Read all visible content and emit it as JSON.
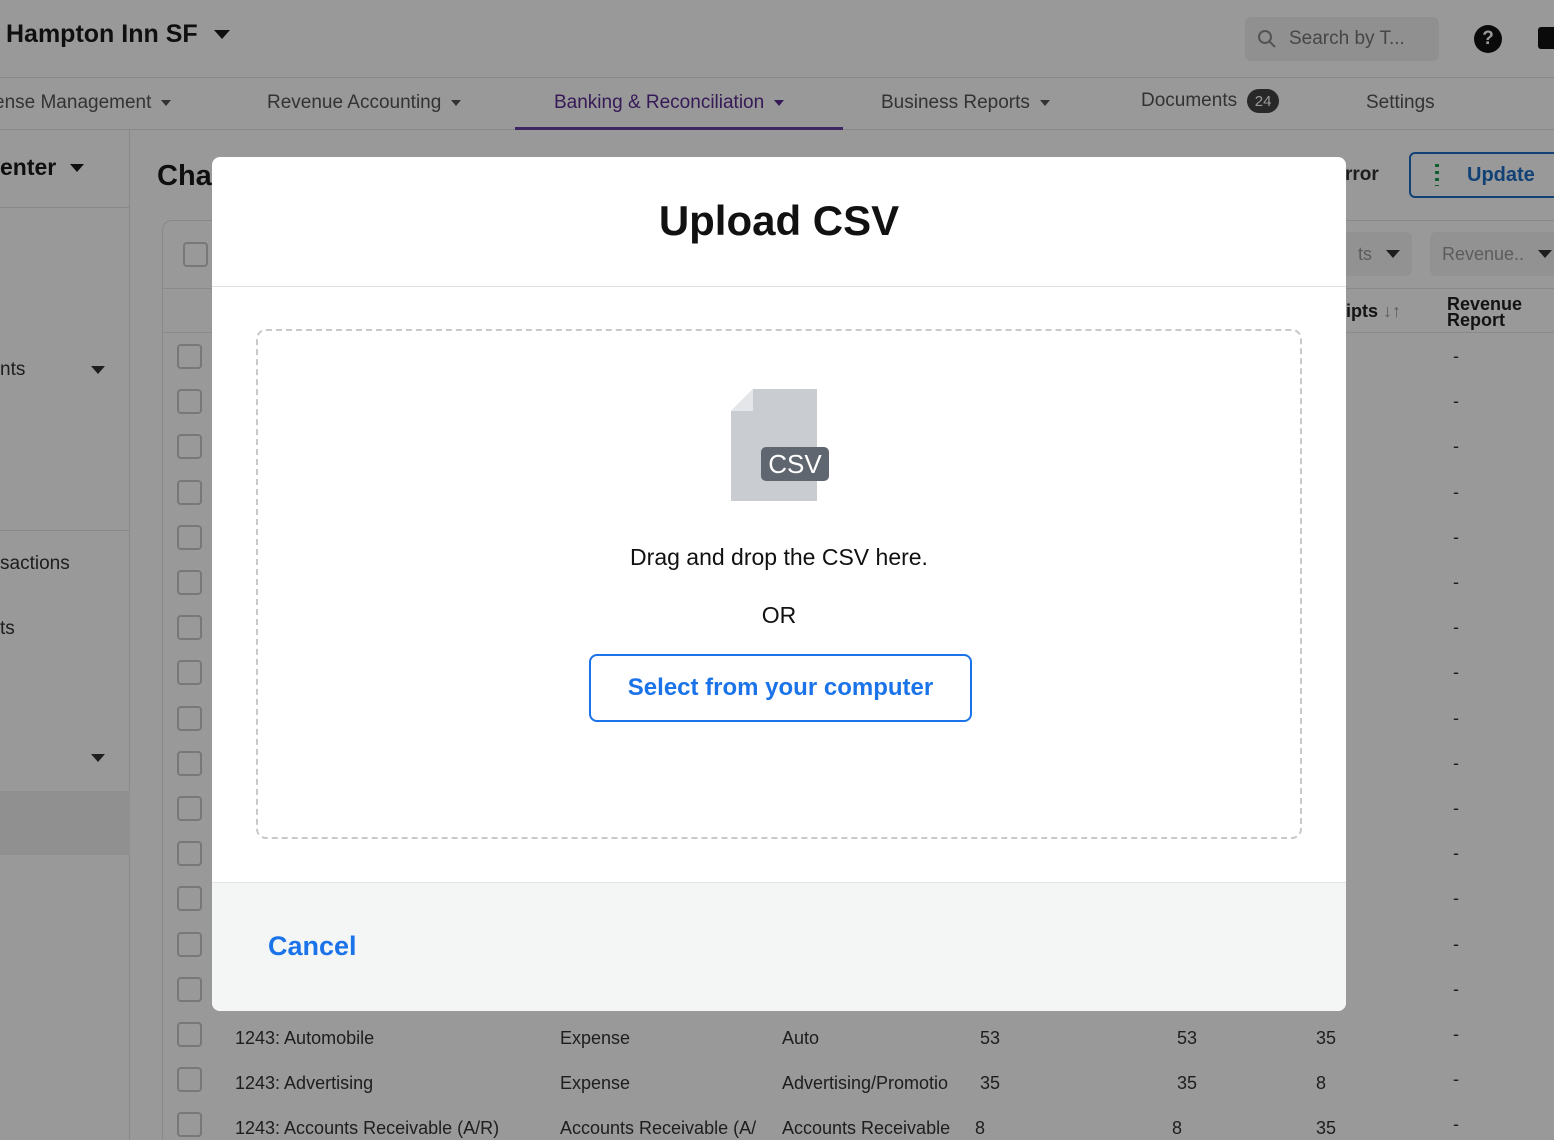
{
  "header": {
    "hotel_name": "Hampton Inn SF",
    "search_placeholder": "Search by T...",
    "help_label": "?"
  },
  "nav": {
    "items": [
      {
        "label": "ense Management"
      },
      {
        "label": "Revenue Accounting"
      },
      {
        "label": "Banking & Reconciliation"
      },
      {
        "label": "Business Reports"
      },
      {
        "label": "Documents",
        "badge": "24"
      },
      {
        "label": "Settings"
      }
    ],
    "active_index": 2
  },
  "sidebar": {
    "heading": "enter",
    "items": [
      {
        "label": "nts"
      },
      {
        "label": "sactions"
      },
      {
        "label": "ts"
      }
    ]
  },
  "page": {
    "title": "Cha",
    "error_text": "rror",
    "update_label": "Update"
  },
  "table": {
    "filters": [
      {
        "label": "ts"
      },
      {
        "label": "Revenue.."
      }
    ],
    "columns": [
      {
        "label": "eipts"
      },
      {
        "label": "Revenue Report"
      }
    ],
    "empty_value": "-",
    "rows": [
      {
        "account": "1243: Automobile",
        "type": "Expense",
        "category": "Auto",
        "c1": "53",
        "c2": "53",
        "c3": "35",
        "report": "-"
      },
      {
        "account": "1243: Advertising",
        "type": "Expense",
        "category": "Advertising/Promotio",
        "c1": "35",
        "c2": "35",
        "c3": "8",
        "report": "-"
      },
      {
        "account": "1243: Accounts Receivable (A/R)",
        "type": "Accounts Receivable (A/",
        "category": "Accounts Receivable",
        "c1": "8",
        "c2": "8",
        "c3": "35",
        "report": "-"
      }
    ]
  },
  "modal": {
    "title": "Upload CSV",
    "file_badge": "CSV",
    "drop_text": "Drag and drop the CSV here.",
    "or_text": "OR",
    "select_label": "Select from your computer",
    "cancel_label": "Cancel"
  },
  "colors": {
    "primary_blue": "#1a73e8",
    "nav_active": "#5b2c91",
    "overlay": "#000000"
  }
}
